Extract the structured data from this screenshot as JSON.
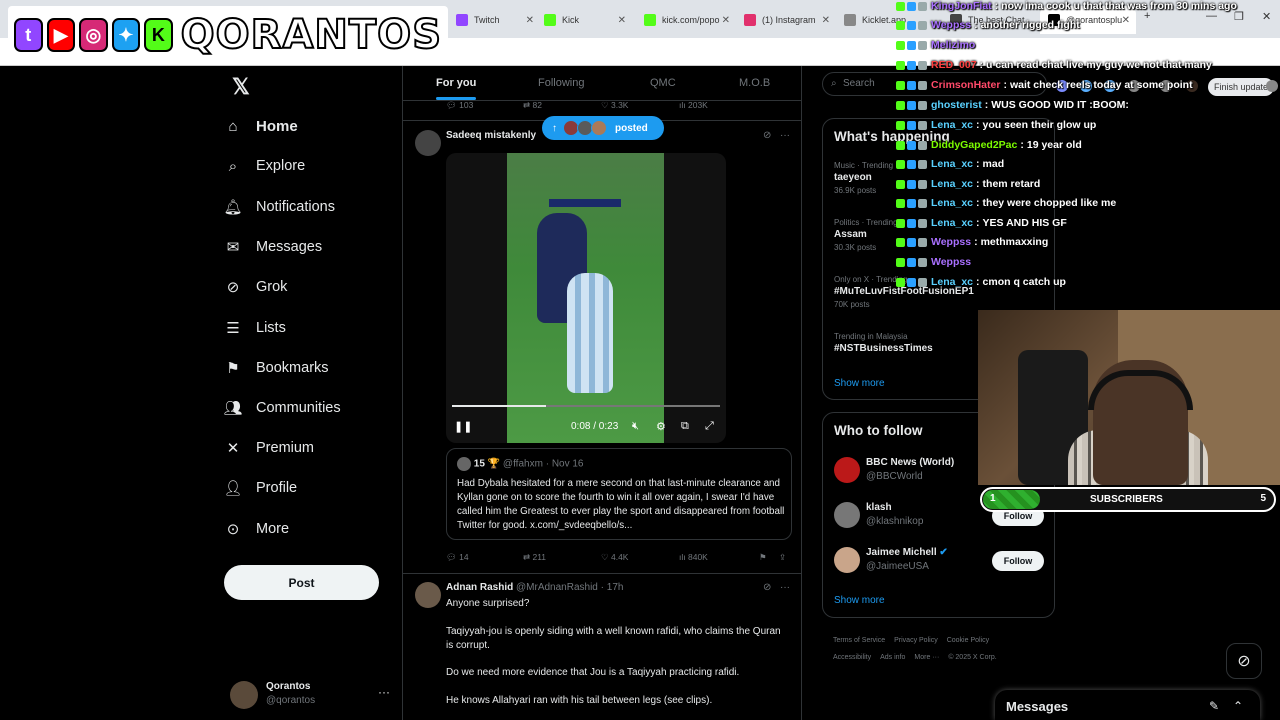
{
  "browser": {
    "tabs": [
      "Twitch",
      "Kick",
      "kick.com/popo",
      "(1) Instagram",
      "Kicklet.app",
      "The best Chat",
      "@qorantosplu"
    ],
    "finish_update": "Finish update"
  },
  "overlay": {
    "channel_name": "QORANTOS"
  },
  "nav": {
    "items": [
      {
        "label": "Home",
        "icon": "home-icon"
      },
      {
        "label": "Explore",
        "icon": "search-icon"
      },
      {
        "label": "Notifications",
        "icon": "bell-icon"
      },
      {
        "label": "Messages",
        "icon": "envelope-icon"
      },
      {
        "label": "Grok",
        "icon": "grok-icon"
      },
      {
        "label": "Lists",
        "icon": "list-icon"
      },
      {
        "label": "Bookmarks",
        "icon": "bookmark-icon"
      },
      {
        "label": "Communities",
        "icon": "people-icon"
      },
      {
        "label": "Premium",
        "icon": "x-icon"
      },
      {
        "label": "Profile",
        "icon": "person-icon"
      },
      {
        "label": "More",
        "icon": "more-circle-icon"
      }
    ],
    "post_label": "Post",
    "account": {
      "name": "Qorantos",
      "handle": "@qorantos"
    }
  },
  "feed": {
    "tabs": [
      "For you",
      "Following",
      "QMC",
      "M.O.B"
    ],
    "prev_stats": {
      "replies": "103",
      "reposts": "82",
      "likes": "3.3K",
      "views": "203K"
    },
    "posted_pill": "posted",
    "tweet1": {
      "author": "Sadeeq mistakenly",
      "video_time": "0:08 / 0:23",
      "video_progress": 0.35,
      "quote": {
        "author": "15 🏆",
        "handle": "@ffahxm",
        "date": "Nov 16",
        "text": "Had Dybala hesitated for a mere second on that last-minute clearance and Kyllan gone on to score the fourth to win it all over again, I swear I'd have called him the Greatest to ever play the sport and disappeared from football Twitter for good. x.com/_svdeeqbello/s..."
      },
      "stats": {
        "replies": "14",
        "reposts": "211",
        "likes": "4.4K",
        "views": "840K"
      }
    },
    "tweet2": {
      "author": "Adnan Rashid",
      "handle": "@MrAdnanRashid",
      "time": "17h",
      "lines": [
        "Anyone surprised?",
        "Taqiyyah-jou is openly siding with a well known rafidi, who claims the Quran is corrupt.",
        "Do we need more evidence that Jou is a Taqiyyah practicing rafidi.",
        "He knows Allahyari ran with his tail between legs (see clips)."
      ]
    }
  },
  "right": {
    "search_placeholder": "Search",
    "whats_happening": "What's happening",
    "trends": [
      {
        "category": "Music · Trending",
        "title": "taeyeon",
        "posts": "36.9K posts"
      },
      {
        "category": "Politics · Trending",
        "title": "Assam",
        "posts": "30.3K posts"
      },
      {
        "category": "Only on X · Trending",
        "title": "#MuTeLuvFistFootFusionEP1",
        "posts": "70K posts"
      },
      {
        "category": "Trending in Malaysia",
        "title": "#NSTBusinessTimes",
        "posts": ""
      }
    ],
    "show_more": "Show more",
    "who_to_follow": "Who to follow",
    "follow_suggestions": [
      {
        "name": "BBC News (World)",
        "handle": "@BBCWorld",
        "button": ""
      },
      {
        "name": "klash",
        "handle": "@klashnikop",
        "button": "Follow"
      },
      {
        "name": "Jaimee Michell",
        "handle": "@JaimeeUSA",
        "button": "Follow"
      }
    ],
    "footer_links": [
      "Terms of Service",
      "Privacy Policy",
      "Cookie Policy",
      "Accessibility",
      "Ads info",
      "More ···",
      "© 2025 X Corp."
    ]
  },
  "chat": [
    {
      "user": "KingJonFiat",
      "color": "#a970ff",
      "text": "now ima cook u that that was from 30 mins ago"
    },
    {
      "user": "Weppss",
      "color": "#a970ff",
      "text": "another rigged fight"
    },
    {
      "user": "Melizimo",
      "color": "#a970ff",
      "text": ""
    },
    {
      "user": "RED_007",
      "color": "#ff4040",
      "text": "u can read chat live my guy we not that many"
    },
    {
      "user": "CrimsonHater",
      "color": "#ff4a6a",
      "text": "wait check reels today at some point"
    },
    {
      "user": "ghosterist",
      "color": "#5ad1ff",
      "text": "WUS GOOD WID IT :BOOM:"
    },
    {
      "user": "Lena_xc",
      "color": "#5ad1ff",
      "text": "you seen their glow up"
    },
    {
      "user": "DiddyGaped2Pac",
      "color": "#7cfc00",
      "text": "19 year old"
    },
    {
      "user": "Lena_xc",
      "color": "#5ad1ff",
      "text": "mad"
    },
    {
      "user": "Lena_xc",
      "color": "#5ad1ff",
      "text": "them retard"
    },
    {
      "user": "Lena_xc",
      "color": "#5ad1ff",
      "text": "they were chopped like me"
    },
    {
      "user": "Lena_xc",
      "color": "#5ad1ff",
      "text": "YES AND HIS GF"
    },
    {
      "user": "Weppss",
      "color": "#a970ff",
      "text": "methmaxxing"
    },
    {
      "user": "Weppss",
      "color": "#a970ff",
      "text": ""
    },
    {
      "user": "Lena_xc",
      "color": "#5ad1ff",
      "text": "cmon q catch up"
    }
  ],
  "subscribers": {
    "current": "1",
    "label": "SUBSCRIBERS",
    "goal": "5",
    "progress": 0.2
  },
  "messages_drawer": {
    "title": "Messages"
  }
}
